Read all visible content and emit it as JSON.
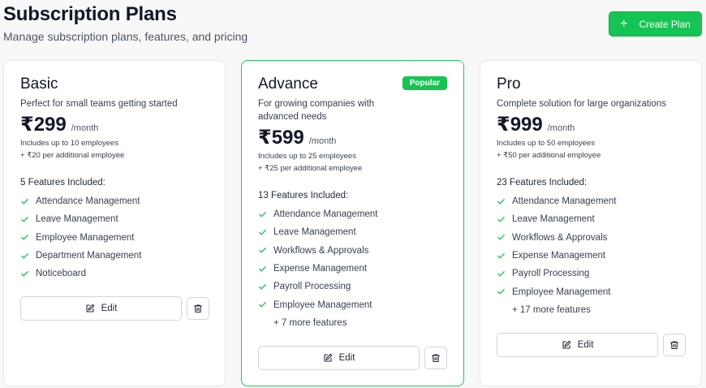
{
  "header": {
    "title": "Subscription Plans",
    "subtitle": "Manage subscription plans, features, and pricing",
    "create_button": "Create Plan"
  },
  "colors": {
    "accent": "#16c453",
    "check": "#22c55e"
  },
  "plans": [
    {
      "name": "Basic",
      "description": "Perfect for small teams getting started",
      "price": "₹299",
      "period": "/month",
      "limit": "Includes up to 10 employees",
      "additional": "+ ₹20 per additional employee",
      "features_title": "5 Features Included:",
      "features": [
        "Attendance Management",
        "Leave Management",
        "Employee Management",
        "Department Management",
        "Noticeboard"
      ],
      "more": "",
      "edit_label": "Edit"
    },
    {
      "name": "Advance",
      "badge": "Popular",
      "description": "For growing companies with advanced needs",
      "price": "₹599",
      "period": "/month",
      "limit": "Includes up to 25 employees",
      "additional": "+ ₹25 per additional employee",
      "features_title": "13 Features Included:",
      "features": [
        "Attendance Management",
        "Leave Management",
        "Workflows & Approvals",
        "Expense Management",
        "Payroll Processing",
        "Employee Management"
      ],
      "more": "+ 7 more features",
      "edit_label": "Edit"
    },
    {
      "name": "Pro",
      "description": "Complete solution for large organizations",
      "price": "₹999",
      "period": "/month",
      "limit": "Includes up to 50 employees",
      "additional": "+ ₹50 per additional employee",
      "features_title": "23 Features Included:",
      "features": [
        "Attendance Management",
        "Leave Management",
        "Workflows & Approvals",
        "Expense Management",
        "Payroll Processing",
        "Employee Management"
      ],
      "more": "+ 17 more features",
      "edit_label": "Edit"
    }
  ]
}
